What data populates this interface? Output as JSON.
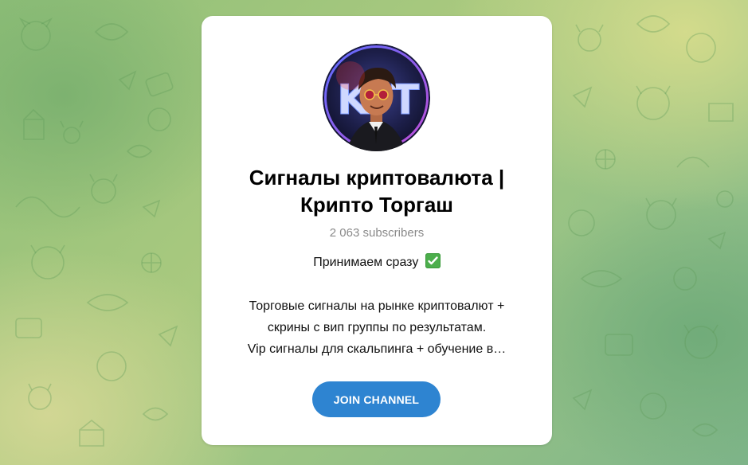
{
  "channel": {
    "title_line1": "Сигналы криптовалюта |",
    "title_line2": "Крипто Торгаш",
    "subscribers": "2 063 subscribers",
    "status": "Принимаем сразу",
    "status_emoji_icon": "check-mark-button-icon",
    "avatar_letters": "KT",
    "description_line1": "Торговые сигналы на рынке криптовалют +",
    "description_line2": "скрины с вип группы по результатам.",
    "description_line3": "Vip сигналы для скальпинга + обучение в…",
    "join_label": "JOIN CHANNEL"
  },
  "colors": {
    "accent": "#2e84d1",
    "muted_text": "#8a8a8a",
    "card_bg": "#ffffff",
    "background_green": "#9cc584"
  }
}
